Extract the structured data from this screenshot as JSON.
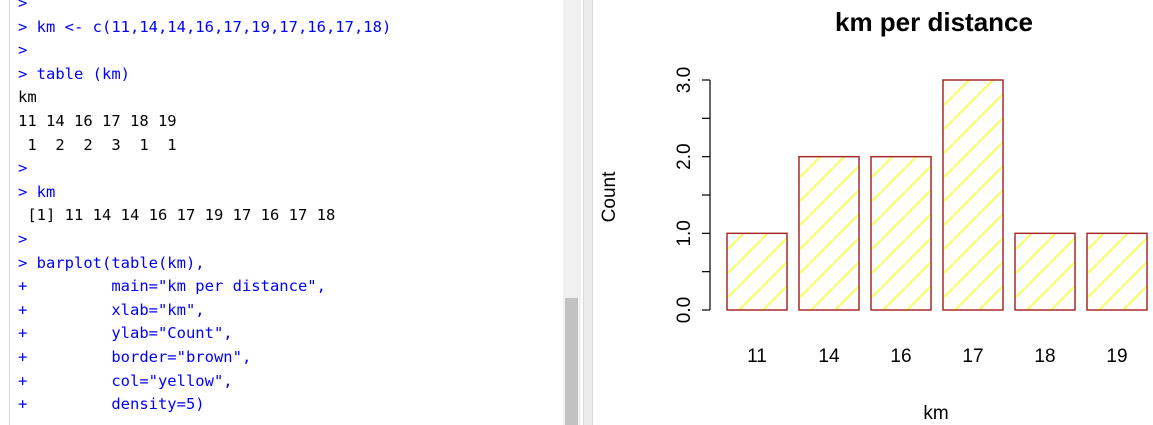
{
  "console": {
    "lines": [
      {
        "kind": "cmd",
        "text": ">"
      },
      {
        "kind": "cmd",
        "text": "> km <- c(11,14,14,16,17,19,17,16,17,18)"
      },
      {
        "kind": "cmd",
        "text": ">"
      },
      {
        "kind": "cmd",
        "text": "> table (km)"
      },
      {
        "kind": "out",
        "text": "km"
      },
      {
        "kind": "out",
        "text": "11 14 16 17 18 19"
      },
      {
        "kind": "out",
        "text": " 1  2  2  3  1  1"
      },
      {
        "kind": "cmd",
        "text": ">"
      },
      {
        "kind": "cmd",
        "text": "> km"
      },
      {
        "kind": "out",
        "text": " [1] 11 14 14 16 17 19 17 16 17 18"
      },
      {
        "kind": "cmd",
        "text": ">"
      },
      {
        "kind": "cmd",
        "text": "> barplot(table(km),"
      },
      {
        "kind": "cmd",
        "text": "+         main=\"km per distance\","
      },
      {
        "kind": "cmd",
        "text": "+         xlab=\"km\","
      },
      {
        "kind": "cmd",
        "text": "+         ylab=\"Count\","
      },
      {
        "kind": "cmd",
        "text": "+         border=\"brown\","
      },
      {
        "kind": "cmd",
        "text": "+         col=\"yellow\","
      },
      {
        "kind": "cmd",
        "text": "+         density=5)"
      }
    ]
  },
  "colors": {
    "command": "#0000ff",
    "output": "#000000",
    "bar_border": "#a52a2a",
    "bar_hatch": "#ffff00"
  },
  "chart_data": {
    "type": "bar",
    "title": "km per distance",
    "xlabel": "km",
    "ylabel": "Count",
    "categories": [
      "11",
      "14",
      "16",
      "17",
      "18",
      "19"
    ],
    "values": [
      1,
      2,
      2,
      3,
      1,
      1
    ],
    "ylim": [
      0,
      3
    ],
    "yticks": [
      0,
      0.5,
      1,
      1.5,
      2,
      2.5,
      3
    ],
    "ytick_labels": [
      "0.0",
      "",
      "1.0",
      "",
      "2.0",
      "",
      "3.0"
    ],
    "grid": false,
    "legend": "none",
    "fill": "diagonal hatch"
  }
}
